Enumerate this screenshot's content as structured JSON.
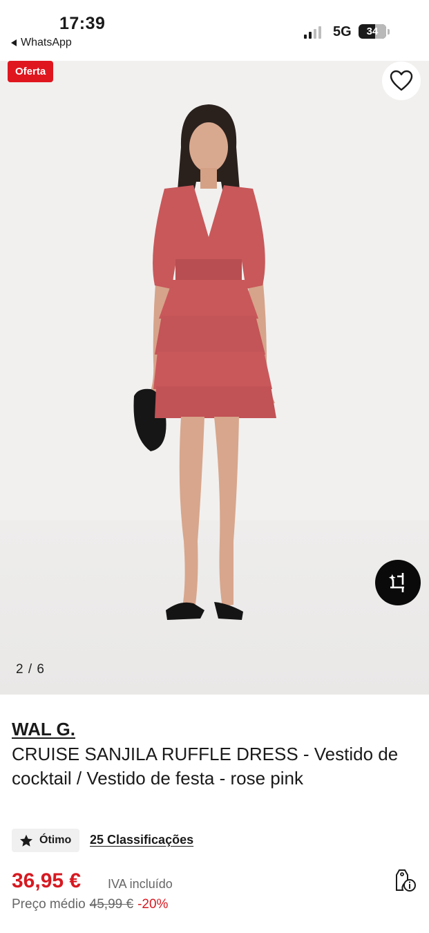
{
  "status_bar": {
    "time": "17:39",
    "back_app": "WhatsApp",
    "network": "5G",
    "battery": "34"
  },
  "gallery": {
    "badge": "Oferta",
    "counter": "2 / 6",
    "favorite_icon": "heart-outline-icon",
    "crop_icon": "sparkle-crop-icon"
  },
  "product": {
    "brand": "WAL G.",
    "title": "CRUISE SANJILA RUFFLE DRESS - Vestido de cocktail / Vestido de festa - rose pink",
    "rating_label": "Ótimo",
    "reviews_link": "25 Classificações",
    "price": "36,95 €",
    "vat_note": "IVA incluído",
    "avg_label": "Preço médio",
    "old_price": "45,99 €",
    "discount": "-20%"
  },
  "colors": {
    "accent_red": "#d71921",
    "badge_red": "#e0161f",
    "dress_color": "#c8585a"
  }
}
